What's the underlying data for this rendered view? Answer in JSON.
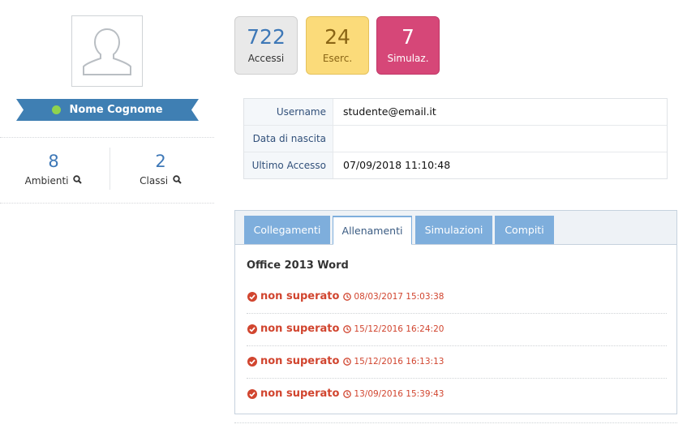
{
  "profile": {
    "name": "Nome Cognome",
    "online_color": "#8fd24e",
    "ribbon_color": "#3f7fb3",
    "stats": [
      {
        "value": "8",
        "label": "Ambienti",
        "icon": "search-icon"
      },
      {
        "value": "2",
        "label": "Classi",
        "icon": "search-icon"
      }
    ]
  },
  "counters": [
    {
      "value": "722",
      "label": "Accessi",
      "color": "#e9e9e9"
    },
    {
      "value": "24",
      "label": "Eserc.",
      "color": "#fbdb7a"
    },
    {
      "value": "7",
      "label": "Simulaz.",
      "color": "#d64778"
    }
  ],
  "info": [
    {
      "key": "Username",
      "value": "studente@email.it"
    },
    {
      "key": "Data di nascita",
      "value": ""
    },
    {
      "key": "Ultimo Accesso",
      "value": "07/09/2018 11:10:48"
    }
  ],
  "tabs": [
    {
      "label": "Collegamenti",
      "active": false
    },
    {
      "label": "Allenamenti",
      "active": true
    },
    {
      "label": "Simulazioni",
      "active": false
    },
    {
      "label": "Compiti",
      "active": false
    }
  ],
  "course": {
    "title": "Office 2013 Word",
    "results": [
      {
        "status": "non superato",
        "time": "08/03/2017 15:03:38"
      },
      {
        "status": "non superato",
        "time": "15/12/2016 16:24:20"
      },
      {
        "status": "non superato",
        "time": "15/12/2016 16:13:13"
      },
      {
        "status": "non superato",
        "time": "13/09/2016 15:39:43"
      }
    ],
    "status_color": "#d1452f"
  }
}
